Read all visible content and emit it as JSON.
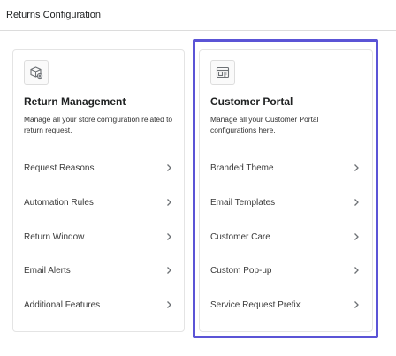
{
  "header": {
    "title": "Returns Configuration"
  },
  "cards": [
    {
      "icon": "package-settings-icon",
      "title": "Return Management",
      "description": "Manage all your store configuration related to return request.",
      "items": [
        {
          "label": "Request Reasons"
        },
        {
          "label": "Automation Rules"
        },
        {
          "label": "Return Window"
        },
        {
          "label": "Email Alerts"
        },
        {
          "label": "Additional Features"
        }
      ]
    },
    {
      "icon": "portal-window-icon",
      "title": "Customer Portal",
      "description": "Manage all your Customer Portal configurations here.",
      "items": [
        {
          "label": "Branded Theme"
        },
        {
          "label": "Email Templates"
        },
        {
          "label": "Customer Care"
        },
        {
          "label": "Custom Pop-up"
        },
        {
          "label": "Service Request Prefix"
        }
      ]
    }
  ],
  "colors": {
    "accent": "#5b54d6",
    "chevron": "#6d7175"
  }
}
